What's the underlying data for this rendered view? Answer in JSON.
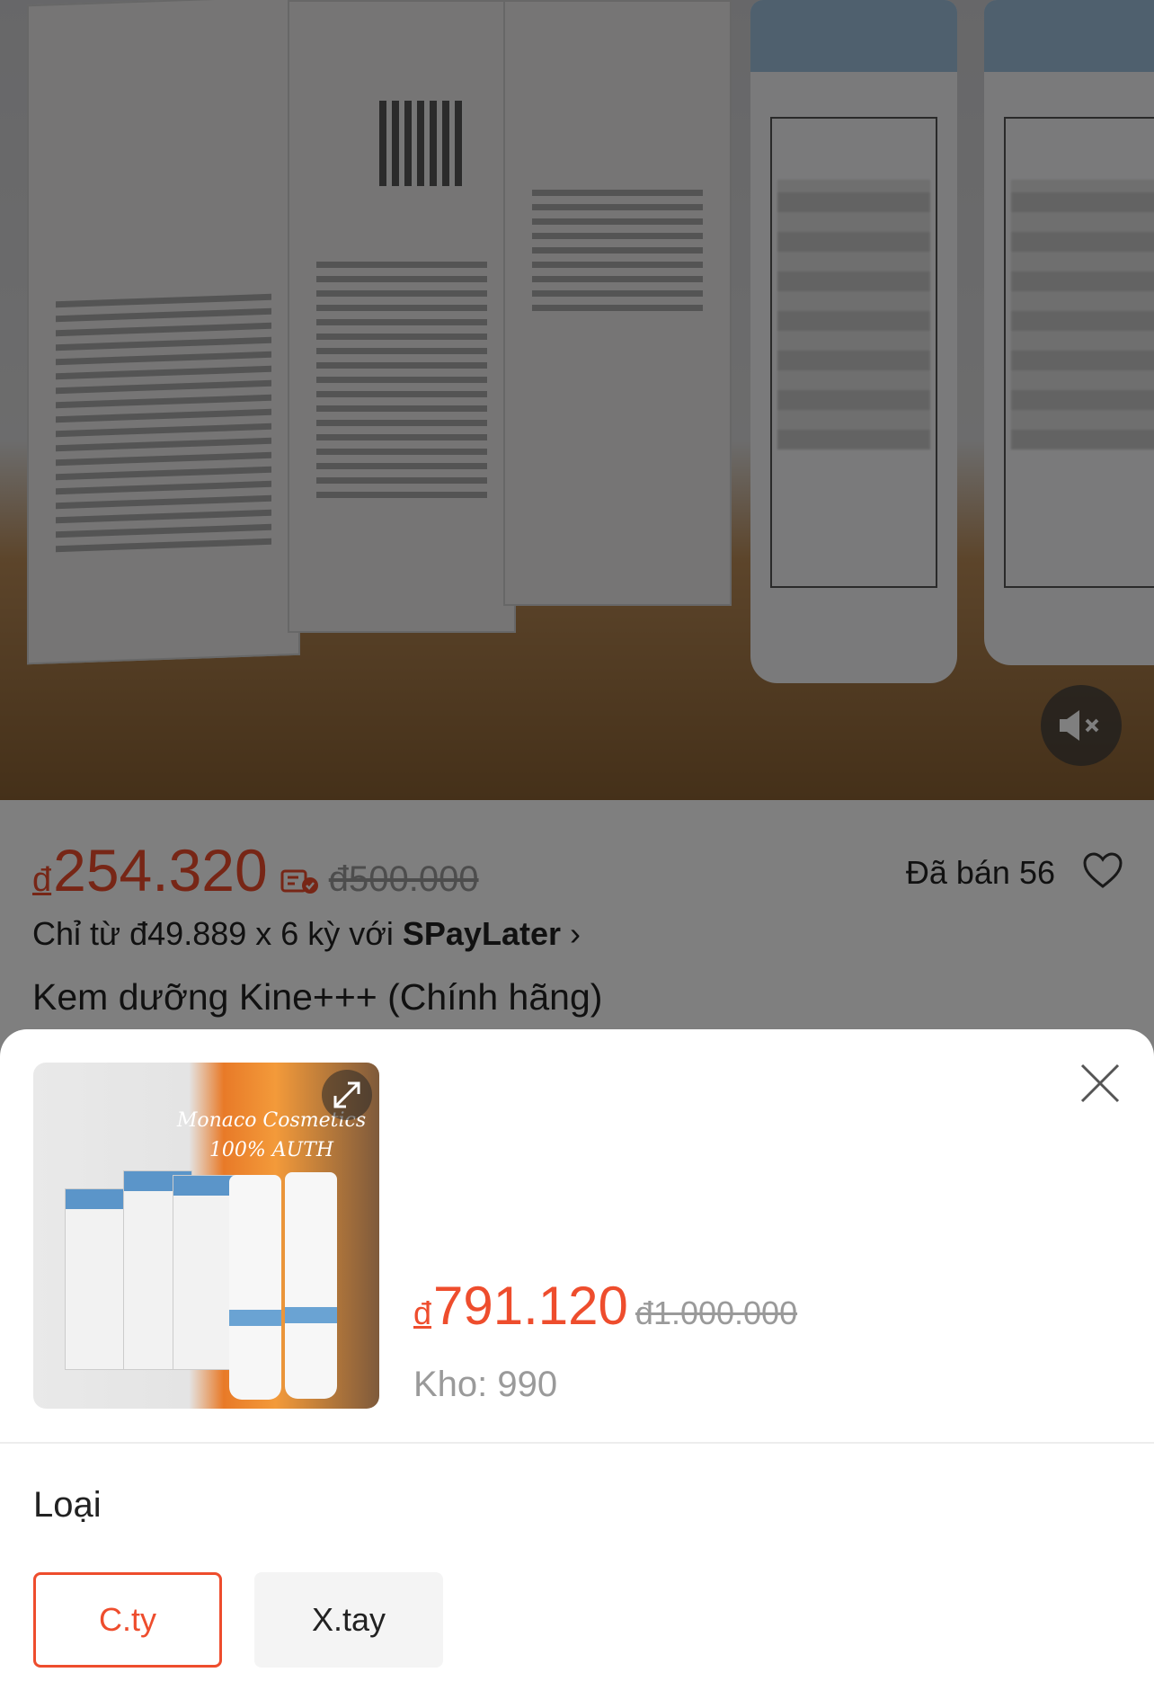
{
  "colors": {
    "accent": "#ee4d2d",
    "muted": "#9a9a9a",
    "text": "#222222"
  },
  "product_page": {
    "price": {
      "currency": "đ",
      "value": "254.320",
      "original": "đ500.000"
    },
    "sold_text": "Đã bán 56",
    "paylater": {
      "prefix": "Chỉ từ đ49.889 x 6 kỳ với ",
      "brand": "SPayLater",
      "chevron": "›"
    },
    "title": "Kem dưỡng Kine+++ (Chính hãng)",
    "icons": {
      "mute": "speaker-muted-icon",
      "favorite": "heart-outline-icon",
      "voucher": "price-tag-check-icon"
    }
  },
  "sheet": {
    "thumbnail": {
      "line1": "Monaco Cosmetics",
      "line2": "100% AUTH"
    },
    "price": {
      "currency": "đ",
      "value": "791.120",
      "original": "đ1.000.000"
    },
    "stock": "Kho: 990",
    "variant_label": "Loại",
    "options": [
      {
        "label": "C.ty",
        "selected": true
      },
      {
        "label": "X.tay",
        "selected": false
      }
    ],
    "icons": {
      "close": "close-icon",
      "expand": "expand-icon"
    }
  }
}
